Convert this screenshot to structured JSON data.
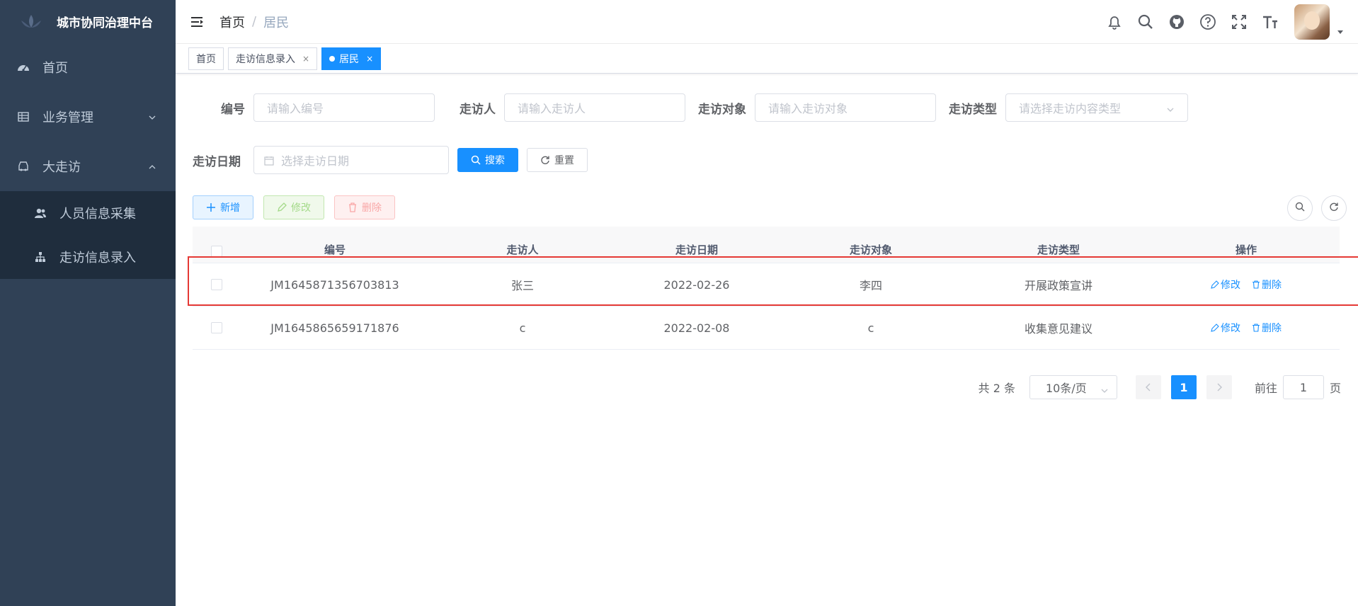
{
  "app": {
    "title": "城市协同治理中台"
  },
  "sidebar": {
    "items": [
      {
        "label": "首页",
        "icon": "dashboard-icon"
      },
      {
        "label": "业务管理",
        "icon": "table-icon",
        "expanded": false
      },
      {
        "label": "大走访",
        "icon": "car-icon",
        "expanded": true,
        "children": [
          {
            "label": "人员信息采集",
            "icon": "peoples-icon"
          },
          {
            "label": "走访信息录入",
            "icon": "tree-icon"
          }
        ]
      }
    ]
  },
  "breadcrumb": {
    "home": "首页",
    "separator": "/",
    "current": "居民"
  },
  "tags": [
    {
      "label": "首页",
      "active": false,
      "closable": false
    },
    {
      "label": "走访信息录入",
      "active": false,
      "closable": true
    },
    {
      "label": "居民",
      "active": true,
      "closable": true
    }
  ],
  "tag_close": "×",
  "search": {
    "fields": [
      {
        "label": "编号",
        "placeholder": "请输入编号"
      },
      {
        "label": "走访人",
        "placeholder": "请输入走访人"
      },
      {
        "label": "走访对象",
        "placeholder": "请输入走访对象"
      },
      {
        "label": "走访类型",
        "placeholder": "请选择走访内容类型"
      },
      {
        "label": "走访日期",
        "placeholder": "选择走访日期"
      }
    ],
    "search_button": "搜索",
    "reset_button": "重置"
  },
  "toolbar": {
    "add": "新增",
    "edit": "修改",
    "delete": "删除"
  },
  "table": {
    "columns": [
      "编号",
      "走访人",
      "走访日期",
      "走访对象",
      "走访类型",
      "操作"
    ],
    "rows": [
      {
        "id": "JM1645871356703813",
        "person": "张三",
        "date": "2022-02-26",
        "target": "李四",
        "type": "开展政策宣讲"
      },
      {
        "id": "JM1645865659171876",
        "person": "c",
        "date": "2022-02-08",
        "target": "c",
        "type": "收集意见建议"
      }
    ],
    "row_actions": {
      "edit": "修改",
      "delete": "删除"
    }
  },
  "pagination": {
    "total_text": "共 2 条",
    "page_size": "10条/页",
    "current_page": "1",
    "goto_label": "前往",
    "goto_value": "1",
    "page_label": "页"
  },
  "colors": {
    "primary": "#1890ff",
    "sidebar_bg": "#304156",
    "highlight": "#e53935"
  }
}
